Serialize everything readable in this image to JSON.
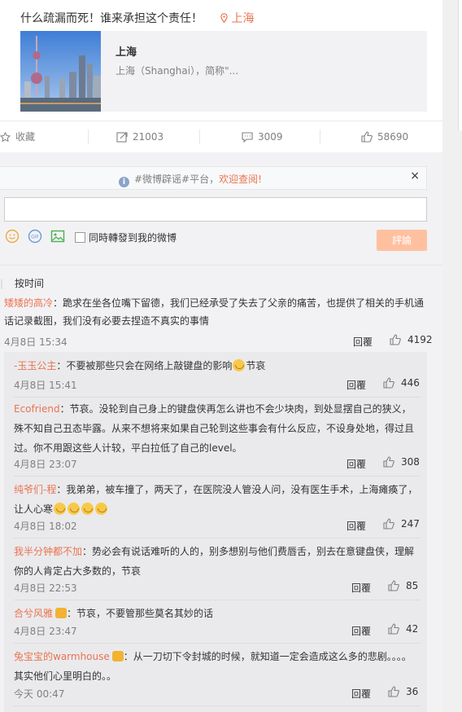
{
  "post": {
    "text": "什么疏漏而死！谁来承担这个责任！",
    "location": "上海"
  },
  "place_card": {
    "title": "上海",
    "description": "上海（Shanghai），简称\"..."
  },
  "actions": {
    "favorite": "收藏",
    "repost": "21003",
    "comment": "3009",
    "like": "58690"
  },
  "notice": {
    "prefix": "#微博辟谣#平台，",
    "highlight": "欢迎查阅!",
    "close": "×"
  },
  "composer": {
    "placeholder": "",
    "checkbox_label": "同時轉發到我的微博",
    "submit": "評論"
  },
  "sort": {
    "label": "按时间"
  },
  "main_comment": {
    "name": "矮矮的高冷",
    "text": "：跪求在坐各位嘴下留德，我们已经承受了失去了父亲的痛苦，也提供了相关的手机通话记录截图，我们没有必要去捏造不真实的事情",
    "time": "4月8日 15:34",
    "reply": "回覆",
    "likes": "4192"
  },
  "replies": [
    {
      "name": "-玉玉公主",
      "text": "：不要被那些只会在网络上敲键盘的影响",
      "suffix": "节哀",
      "time": "4月8日 15:41",
      "reply": "回覆",
      "likes": "446"
    },
    {
      "name": "Ecofriend",
      "text": "：节哀。没轮到自己身上的键盘侠再怎么讲也不会少块肉，到处显摆自己的狭义，殊不知自己丑态毕露。从来不想将来如果自己轮到这些事会有什么反应，不设身处地，得过且过。你不用跟这些人计较，平白拉低了自己的level。",
      "time": "4月8日 23:07",
      "reply": "回覆",
      "likes": "308"
    },
    {
      "name": "纯爷们-程",
      "text": "：我弟弟，被车撞了，两天了，在医院没人管没人问，没有医生手术，上海瘫痪了，让人心寒",
      "time": "4月8日 18:02",
      "reply": "回覆",
      "likes": "247"
    },
    {
      "name": "我半分钟都不加",
      "text": "：势必会有说话难听的人的，别多想别与他们费唇舌，别去在意键盘侠，理解你的人肯定占大多数的，节哀",
      "time": "4月8日 22:53",
      "reply": "回覆",
      "likes": "85"
    },
    {
      "name": "合兮风雅",
      "text": "：节哀，不要管那些莫名其妙的话",
      "time": "4月8日 23:47",
      "reply": "回覆",
      "likes": "42"
    },
    {
      "name": "兔宝宝的warmhouse",
      "text": "：从一刀切下令封城的时候，就知道一定会造成这么多的悲剧。。。。其实他们心里明白的。。",
      "time": "今天 00:47",
      "reply": "回覆",
      "likes": "36"
    }
  ],
  "colors": {
    "accent": "#eb7350",
    "muted": "#808080",
    "submit_bg": "#ffc09f"
  }
}
